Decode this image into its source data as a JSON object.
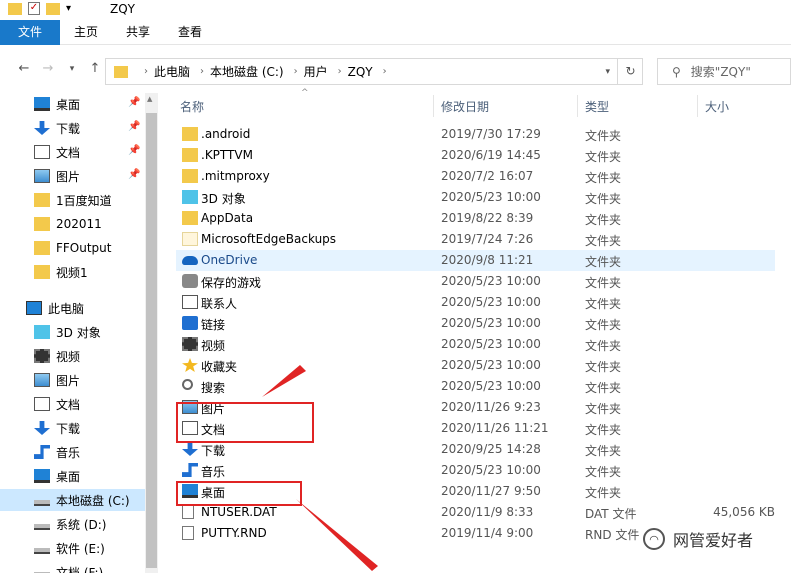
{
  "window": {
    "title": "ZQY"
  },
  "ribbon": {
    "tabs": [
      "文件",
      "主页",
      "共享",
      "查看"
    ]
  },
  "address": {
    "crumbs": [
      "此电脑",
      "本地磁盘 (C:)",
      "用户",
      "ZQY"
    ],
    "search_placeholder": "搜索\"ZQY\""
  },
  "sidebar": {
    "quick_access": [
      {
        "label": "桌面",
        "icon": "desktop-icon",
        "pinned": true
      },
      {
        "label": "下载",
        "icon": "download-icon",
        "pinned": true
      },
      {
        "label": "文档",
        "icon": "document-icon",
        "pinned": true
      },
      {
        "label": "图片",
        "icon": "picture-icon",
        "pinned": true
      },
      {
        "label": "1百度知道",
        "icon": "folder-icon"
      },
      {
        "label": "202011",
        "icon": "folder-icon"
      },
      {
        "label": "FFOutput",
        "icon": "folder-icon"
      },
      {
        "label": "视频1",
        "icon": "folder-icon"
      }
    ],
    "this_pc": {
      "label": "此电脑",
      "icon": "computer-icon"
    },
    "pc_items": [
      {
        "label": "3D 对象",
        "icon": "3d-objects-icon"
      },
      {
        "label": "视频",
        "icon": "video-icon"
      },
      {
        "label": "图片",
        "icon": "picture-icon"
      },
      {
        "label": "文档",
        "icon": "document-icon"
      },
      {
        "label": "下载",
        "icon": "download-icon"
      },
      {
        "label": "音乐",
        "icon": "music-icon"
      },
      {
        "label": "桌面",
        "icon": "desktop-icon"
      },
      {
        "label": "本地磁盘 (C:)",
        "icon": "drive-icon",
        "selected": true
      },
      {
        "label": "系统 (D:)",
        "icon": "drive-icon"
      },
      {
        "label": "软件 (E:)",
        "icon": "drive-icon"
      },
      {
        "label": "文档 (F:)",
        "icon": "drive-icon"
      }
    ]
  },
  "columns": {
    "name": "名称",
    "date": "修改日期",
    "type": "类型",
    "size": "大小"
  },
  "files": [
    {
      "name": ".android",
      "date": "2019/7/30 17:29",
      "type": "文件夹",
      "size": "",
      "icon": "folder-icon"
    },
    {
      "name": ".KPTTVM",
      "date": "2020/6/19 14:45",
      "type": "文件夹",
      "size": "",
      "icon": "folder-icon"
    },
    {
      "name": ".mitmproxy",
      "date": "2020/7/2 16:07",
      "type": "文件夹",
      "size": "",
      "icon": "folder-icon"
    },
    {
      "name": "3D 对象",
      "date": "2020/5/23 10:00",
      "type": "文件夹",
      "size": "",
      "icon": "3d-objects-icon"
    },
    {
      "name": "AppData",
      "date": "2019/8/22 8:39",
      "type": "文件夹",
      "size": "",
      "icon": "folder-icon"
    },
    {
      "name": "MicrosoftEdgeBackups",
      "date": "2019/7/24 7:26",
      "type": "文件夹",
      "size": "",
      "icon": "folder-light-icon"
    },
    {
      "name": "OneDrive",
      "date": "2020/9/8 11:21",
      "type": "文件夹",
      "size": "",
      "icon": "cloud-icon",
      "highlight": true
    },
    {
      "name": "保存的游戏",
      "date": "2020/5/23 10:00",
      "type": "文件夹",
      "size": "",
      "icon": "saved-games-icon"
    },
    {
      "name": "联系人",
      "date": "2020/5/23 10:00",
      "type": "文件夹",
      "size": "",
      "icon": "contacts-icon"
    },
    {
      "name": "链接",
      "date": "2020/5/23 10:00",
      "type": "文件夹",
      "size": "",
      "icon": "link-icon"
    },
    {
      "name": "视频",
      "date": "2020/5/23 10:00",
      "type": "文件夹",
      "size": "",
      "icon": "video-icon"
    },
    {
      "name": "收藏夹",
      "date": "2020/5/23 10:00",
      "type": "文件夹",
      "size": "",
      "icon": "favorites-icon"
    },
    {
      "name": "搜索",
      "date": "2020/5/23 10:00",
      "type": "文件夹",
      "size": "",
      "icon": "search-icon"
    },
    {
      "name": "图片",
      "date": "2020/11/26 9:23",
      "type": "文件夹",
      "size": "",
      "icon": "picture-icon"
    },
    {
      "name": "文档",
      "date": "2020/11/26 11:21",
      "type": "文件夹",
      "size": "",
      "icon": "document-icon"
    },
    {
      "name": "下载",
      "date": "2020/9/25 14:28",
      "type": "文件夹",
      "size": "",
      "icon": "download-icon"
    },
    {
      "name": "音乐",
      "date": "2020/5/23 10:00",
      "type": "文件夹",
      "size": "",
      "icon": "music-icon"
    },
    {
      "name": "桌面",
      "date": "2020/11/27 9:50",
      "type": "文件夹",
      "size": "",
      "icon": "desktop-icon"
    },
    {
      "name": "NTUSER.DAT",
      "date": "2020/11/9 8:33",
      "type": "DAT 文件",
      "size": "45,056 KB",
      "icon": "file-icon"
    },
    {
      "name": "PUTTY.RND",
      "date": "2019/11/4 9:00",
      "type": "RND 文件",
      "size": "",
      "icon": "file-icon"
    }
  ],
  "watermark": {
    "text": "网管爱好者"
  },
  "colors": {
    "accent": "#1979ca",
    "annotation": "#e02424",
    "selected": "#cce8ff",
    "hover": "#e5f3ff"
  }
}
